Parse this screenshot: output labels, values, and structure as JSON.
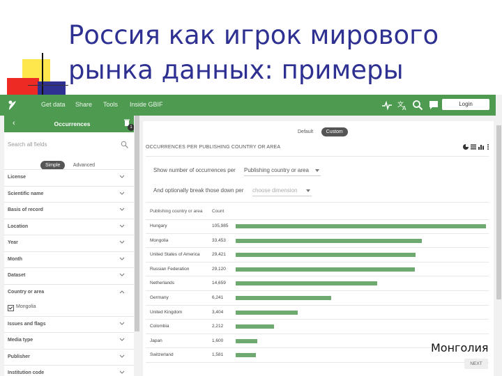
{
  "slide": {
    "title": "Россия как игрок мирового рынка данных: примеры",
    "caption": "Монголия"
  },
  "colors": {
    "title": "#2e3192",
    "brand_green": "#4e9a51",
    "bar_green": "#6eaa6f"
  },
  "topbar": {
    "logo_icon": "gbif-leaf-icon",
    "nav": [
      "Get data",
      "Share",
      "Tools",
      "Inside GBIF"
    ],
    "icons": [
      "pulse-icon",
      "translate-icon",
      "search-icon",
      "chat-icon"
    ],
    "login_label": "Login"
  },
  "sidebar": {
    "title": "Occurrences",
    "badge_count": "1",
    "search_placeholder": "Search all fields",
    "tabs": [
      "Simple",
      "Advanced"
    ],
    "active_tab": "Simple",
    "filters": [
      "License",
      "Scientific name",
      "Basis of record",
      "Location",
      "Year",
      "Month",
      "Dataset",
      "Country or area",
      "Issues and flags",
      "Media type",
      "Publisher",
      "Institution code"
    ],
    "country_selected": "Mongolia"
  },
  "main": {
    "view_tabs": [
      "Default",
      "Custom"
    ],
    "active_view_tab": "Custom",
    "card_title": "OCCURRENCES PER PUBLISHING COUNTRY OR AREA",
    "show_label": "Show number of occurrences per",
    "show_value": "Publishing country or area",
    "break_label": "And optionally break those down per",
    "break_placeholder": "choose dimension",
    "columns": [
      "Publishing country or area",
      "Count"
    ],
    "next_label": "NEXT"
  },
  "chart_data": {
    "type": "bar",
    "orientation": "horizontal",
    "categories": [
      "Hungary",
      "Mongolia",
      "United States of America",
      "Russian Federation",
      "Netherlands",
      "Germany",
      "United Kingdom",
      "Colombia",
      "Japan",
      "Switzerland"
    ],
    "count_labels": [
      "105,985",
      "33,453",
      "29,421",
      "29,120",
      "14,659",
      "6,241",
      "3,404",
      "2,212",
      "1,600",
      "1,581"
    ],
    "bar_fraction": [
      1.0,
      0.745,
      0.718,
      0.715,
      0.566,
      0.381,
      0.247,
      0.153,
      0.086,
      0.081
    ]
  }
}
